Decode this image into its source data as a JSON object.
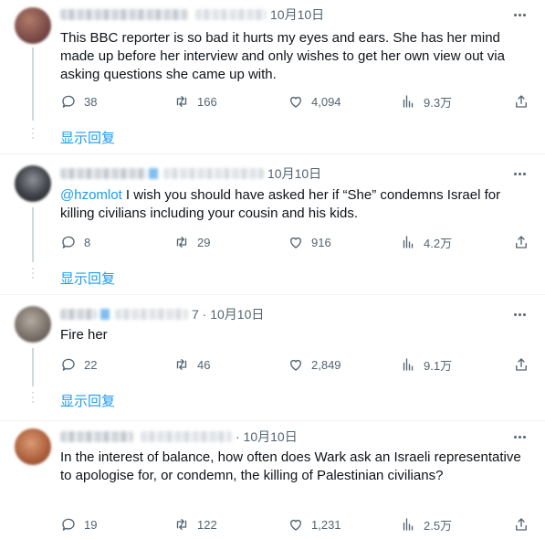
{
  "tweets": [
    {
      "date": "10月10日",
      "mention": "",
      "text": "This BBC reporter is so bad it hurts my eyes and ears. She has her mind made up before her interview and only wishes to get her own view out via asking questions she came up with.",
      "replies": "38",
      "reposts": "166",
      "likes": "4,094",
      "views": "9.3万",
      "show_replies": "显示回复"
    },
    {
      "date": "10月10日",
      "mention": "@hzomlot",
      "text": " I wish you should have asked her if “She” condemns Israel for killing civilians including your cousin and his kids.",
      "replies": "8",
      "reposts": "29",
      "likes": "916",
      "views": "4.2万",
      "show_replies": "显示回复"
    },
    {
      "date": "7 · 10月10日",
      "mention": "",
      "text": "Fire her",
      "replies": "22",
      "reposts": "46",
      "likes": "2,849",
      "views": "9.1万",
      "show_replies": "显示回复"
    },
    {
      "date": "· 10月10日",
      "mention": "",
      "text": "In the interest of balance, how often does Wark ask an Israeli representative to apologise for, or condemn, the killing of Palestinian civilians?",
      "replies": "19",
      "reposts": "122",
      "likes": "1,231",
      "views": "2.5万",
      "show_replies": ""
    }
  ],
  "colors": {
    "accent": "#1d9bf0",
    "secondary_text": "#536471",
    "divider": "#eff3f4"
  },
  "icons": [
    "more-icon",
    "reply-icon",
    "repost-icon",
    "like-icon",
    "views-icon",
    "share-icon"
  ]
}
